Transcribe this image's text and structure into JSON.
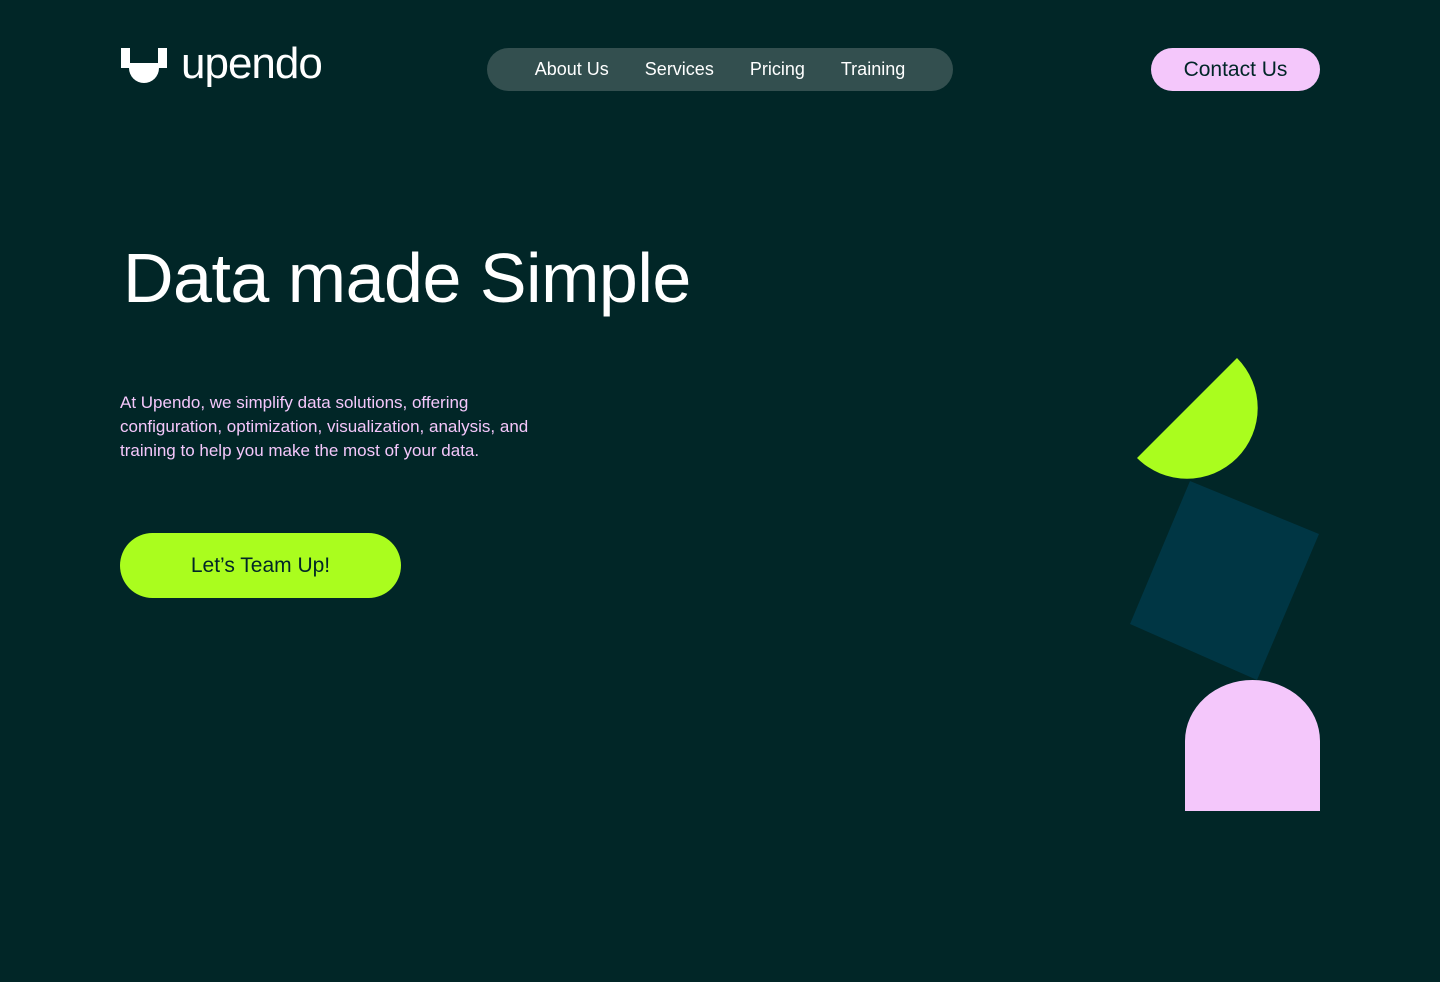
{
  "brand": {
    "name": "upendo",
    "logo_icon": "upendo-u-mark-icon"
  },
  "nav": {
    "items": [
      {
        "label": "About Us"
      },
      {
        "label": "Services"
      },
      {
        "label": "Pricing"
      },
      {
        "label": "Training"
      }
    ],
    "contact_label": "Contact Us"
  },
  "hero": {
    "title": "Data made Simple",
    "description": "At Upendo, we simplify data solutions, offering configuration, optimization, visualization, analysis, and training to help you make the most of your data.",
    "cta_label": "Let’s Team Up!"
  },
  "colors": {
    "background": "#012627",
    "nav_pill": "#334f4f",
    "accent_lime": "#aafd1e",
    "accent_pink": "#f4c7fb",
    "shape_teal": "#003644"
  },
  "decor_icons": [
    "half-circle-shape",
    "tilted-square-shape",
    "arch-shape"
  ]
}
